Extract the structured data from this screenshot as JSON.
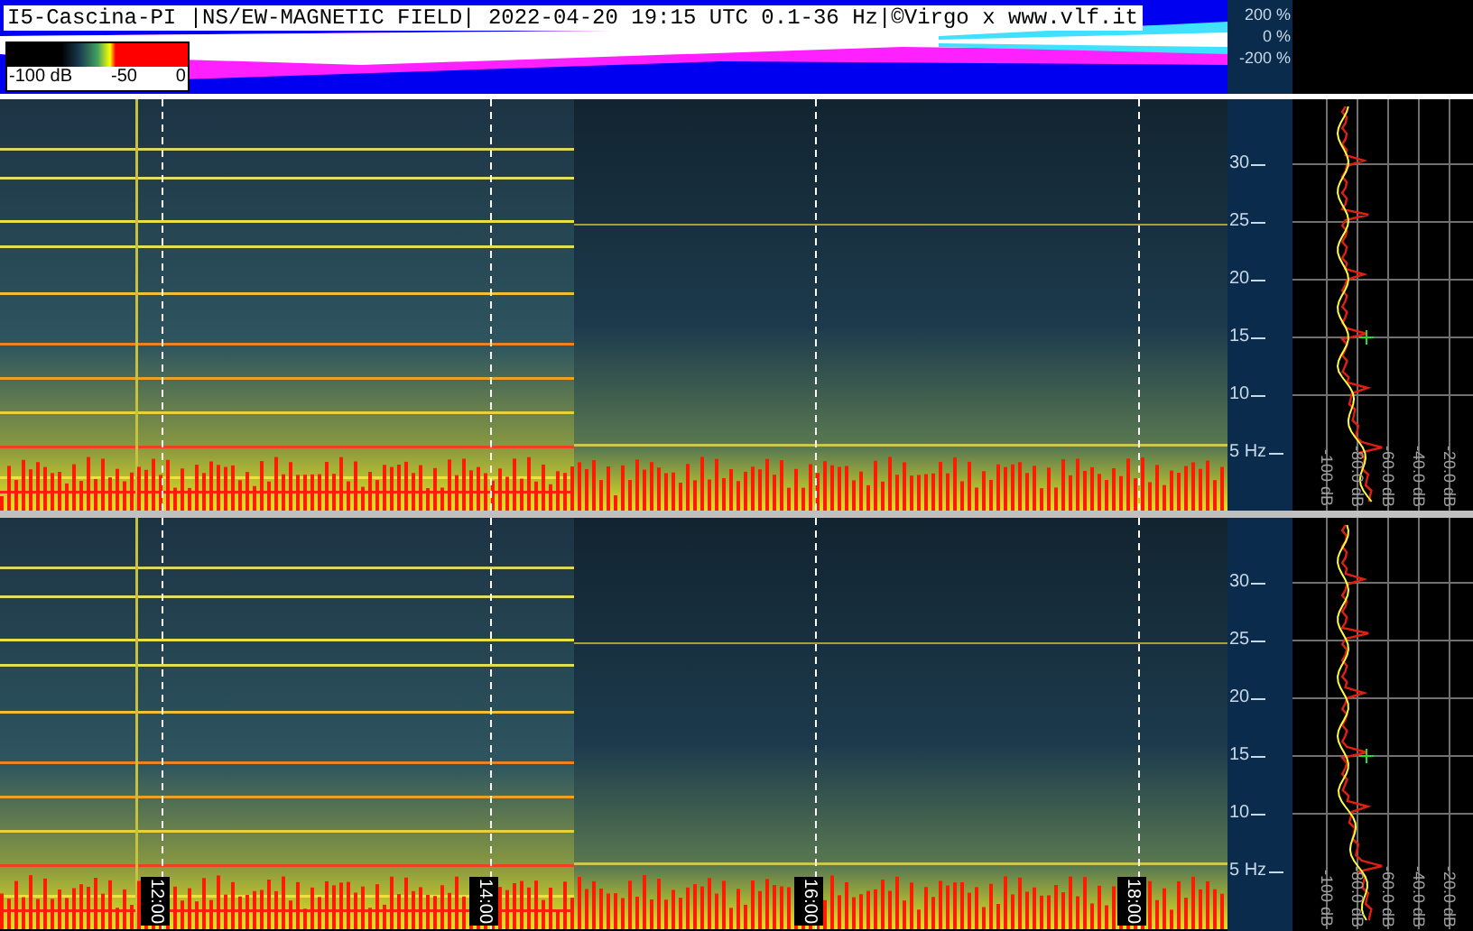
{
  "header": {
    "title": "I5-Cascina-PI |NS/EW-MAGNETIC FIELD| 2022-04-20 19:15 UTC 0.1-36 Hz|©Virgo x www.vlf.it",
    "colorbar_labels": [
      "-100 dB",
      "-50",
      "0"
    ],
    "percent_axis": [
      "200 %",
      "0 %",
      "-200 %"
    ]
  },
  "panels": [
    {
      "frequency_ticks": [
        "30",
        "25",
        "20",
        "15",
        "10",
        "5 Hz"
      ],
      "spectrum_db_labels": [
        "-100 dB",
        "-80.0 dB",
        "-60.0 dB",
        "-40.0 dB",
        "-20.0 dB"
      ]
    },
    {
      "frequency_ticks": [
        "30",
        "25",
        "20",
        "15",
        "10",
        "5 Hz"
      ],
      "spectrum_db_labels": [
        "-100 dB",
        "-80.0 dB",
        "-60.0 dB",
        "-40.0 dB",
        "-20.0 dB"
      ],
      "time_labels": [
        "12:00",
        "14:00",
        "16:00",
        "18:00"
      ]
    }
  ]
}
